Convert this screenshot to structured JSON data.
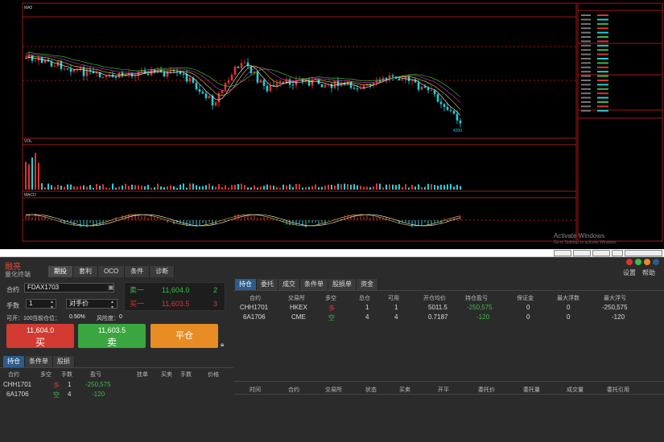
{
  "trade_panel": {
    "logo_line1": "融亮",
    "logo_line2": "量化终端",
    "top_tabs": [
      "期投",
      "套利",
      "OCO",
      "条件",
      "诊断"
    ],
    "order_form": {
      "contract_label": "合约",
      "contract_value": "FDAX1703",
      "lots_label": "手数",
      "lots_value": "1",
      "price_type": "对手价",
      "available_label": "可开：100",
      "position_label": "当前仓位：",
      "position_value": "0.50%",
      "risk_label": "风险度：",
      "risk_value": "0"
    },
    "quote": {
      "ask_label": "卖一",
      "ask_price": "11,604.0",
      "ask_qty": "2",
      "bid_label": "买一",
      "bid_price": "11,603.5",
      "bid_qty": "3"
    },
    "buttons": {
      "buy_price": "11,604.0",
      "buy_label": "买",
      "sell_price": "11,603.5",
      "sell_label": "卖",
      "close_label": "平仓"
    },
    "left_tabs": [
      "持仓",
      "条件单",
      "股损"
    ],
    "left_headers": [
      "合约",
      "多空",
      "手数",
      "盈亏",
      "挂单",
      "买卖",
      "手数",
      "价格"
    ],
    "left_rows": [
      {
        "contract": "CHH1701",
        "side": "多",
        "qty": "1",
        "pnl": "-250,575"
      },
      {
        "contract": "6A1706",
        "side": "空",
        "qty": "4",
        "pnl": "-120"
      }
    ],
    "right_tabs": [
      "持仓",
      "委托",
      "成交",
      "条件单",
      "股损单",
      "资金"
    ],
    "right_headers": [
      "合约",
      "交易所",
      "多空",
      "总仓",
      "可用",
      "开仓均价",
      "持仓盈亏",
      "保证金",
      "最大浮数",
      "最大浮亏"
    ],
    "right_rows": [
      {
        "contract": "CHH1701",
        "exchange": "HKEX",
        "side": "多",
        "total": "1",
        "avail": "1",
        "avg": "5011.5",
        "pnl": "-250,575",
        "margin": "0",
        "maxq": "0",
        "maxloss": "-250,575"
      },
      {
        "contract": "6A1706",
        "exchange": "CME",
        "side": "空",
        "total": "4",
        "avail": "4",
        "avg": "0.7187",
        "pnl": "-120",
        "margin": "0",
        "maxq": "0",
        "maxloss": "-120"
      }
    ],
    "order_headers": [
      "时间",
      "合约",
      "交易所",
      "状态",
      "买卖",
      "开平",
      "委托价",
      "委托量",
      "成交量",
      "委托引用"
    ],
    "settings_label": "设置",
    "help_label": "帮助"
  },
  "chart": {
    "watermark_line1": "Activate Windows",
    "watermark_line2": "Go to Settings to activate Windows.",
    "vol_label": "VOL",
    "macd_label": "MACD",
    "low_label": "4200",
    "ma_label": "MA5"
  },
  "colors": {
    "up": "#e0332f",
    "down": "#21d0d8",
    "grid": "#a01818",
    "buy": "#d23a32",
    "sell": "#3aa63f",
    "close": "#e88c24"
  }
}
